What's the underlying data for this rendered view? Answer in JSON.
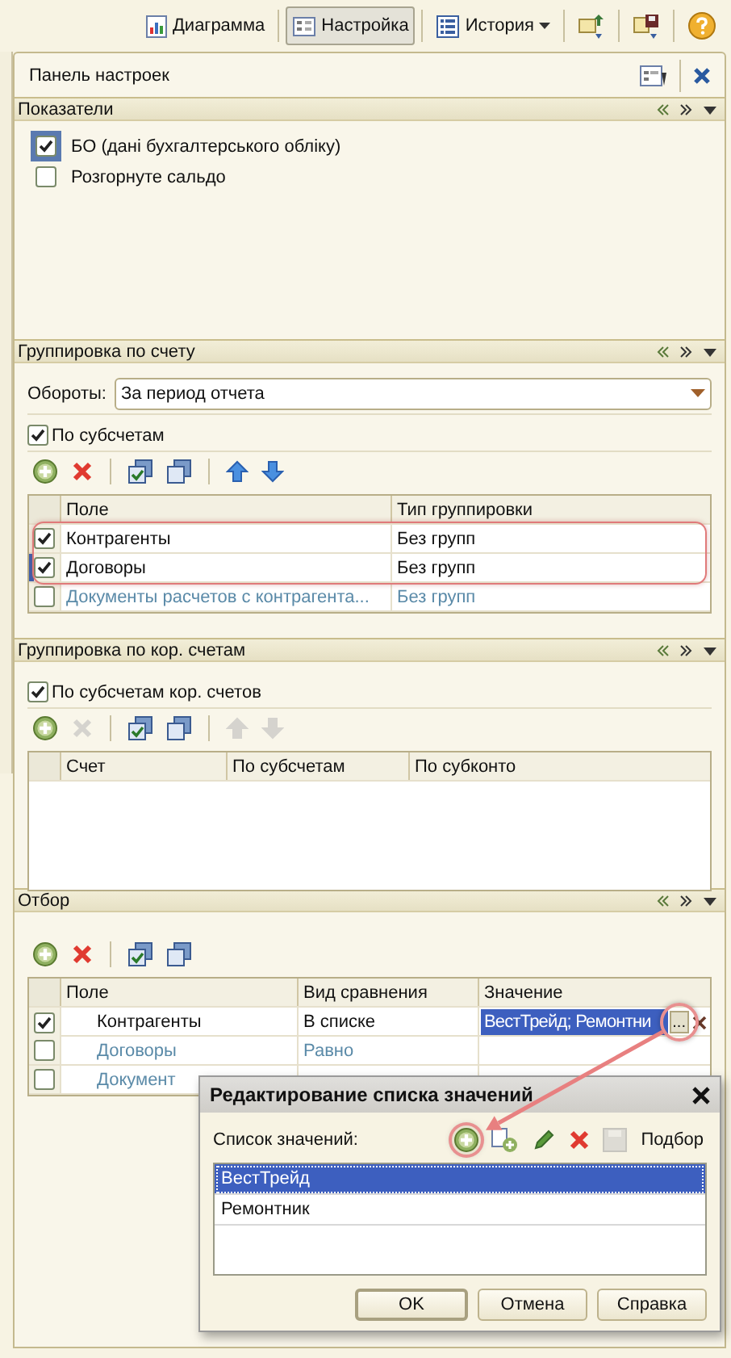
{
  "toolbar": {
    "buttons": [
      {
        "kind": "chart",
        "label": "Диаграмма",
        "selected": false
      },
      {
        "kind": "settings",
        "label": "Настройка",
        "selected": true
      },
      {
        "kind": "history",
        "label": "История",
        "selected": false
      },
      {
        "kind": "export",
        "selected": false
      },
      {
        "kind": "save",
        "selected": false
      },
      {
        "kind": "help",
        "selected": false
      }
    ]
  },
  "panel": {
    "title": "Панель настроек",
    "sections": [
      {
        "kind": "checklist",
        "title": "Показатели",
        "items": [
          {
            "label": "БО (дані бухгалтерського обліку)",
            "checked": true,
            "current": true
          },
          {
            "label": "Розгорнуте сальдо",
            "checked": false,
            "current": false
          }
        ]
      },
      {
        "kind": "grouping",
        "title": "Группировка по счету",
        "select": {
          "label": "Обороты:",
          "value": "За период отчета"
        },
        "option": {
          "label": "По субсчетам",
          "checked": true
        },
        "tools": [
          {
            "kind": "add",
            "disabled": false
          },
          {
            "kind": "delete",
            "disabled": false
          },
          {
            "kind": "check-all",
            "disabled": false
          },
          {
            "kind": "uncheck-all",
            "disabled": false
          },
          {
            "kind": "up",
            "disabled": false
          },
          {
            "kind": "down",
            "disabled": false
          }
        ],
        "columns": [
          "Поле",
          "Тип группировки"
        ],
        "rows": [
          {
            "checked": true,
            "active": true,
            "current": false,
            "highlighted": true,
            "cells": [
              "Контрагенты",
              "Без групп"
            ]
          },
          {
            "checked": true,
            "active": true,
            "current": true,
            "highlighted": true,
            "cells": [
              "Договоры",
              "Без групп"
            ]
          },
          {
            "checked": false,
            "active": false,
            "current": false,
            "highlighted": false,
            "cells": [
              "Документы расчетов с контрагента...",
              "Без групп"
            ]
          }
        ]
      },
      {
        "kind": "grouping",
        "title": "Группировка по кор. счетам",
        "option": {
          "label": "По субсчетам кор. счетов",
          "checked": true
        },
        "tools": [
          {
            "kind": "add",
            "disabled": false
          },
          {
            "kind": "delete",
            "disabled": true
          },
          {
            "kind": "check-all",
            "disabled": false
          },
          {
            "kind": "uncheck-all",
            "disabled": false
          },
          {
            "kind": "up",
            "disabled": true
          },
          {
            "kind": "down",
            "disabled": true
          }
        ],
        "columns": [
          "Счет",
          "По субсчетам",
          "По субконто"
        ]
      },
      {
        "kind": "filter",
        "title": "Отбор",
        "tools": [
          {
            "kind": "add",
            "disabled": false
          },
          {
            "kind": "delete",
            "disabled": false
          },
          {
            "kind": "check-all",
            "disabled": false
          },
          {
            "kind": "uncheck-all",
            "disabled": false
          }
        ],
        "columns": [
          "Поле",
          "Вид сравнения",
          "Значение"
        ],
        "rows": [
          {
            "checked": true,
            "active": true,
            "cells": [
              "Контрагенты",
              "В списке",
              "ВестТрейд; Ремонтни"
            ],
            "choose_label": "..."
          },
          {
            "checked": false,
            "active": false,
            "cells": [
              "Договоры",
              "Равно"
            ]
          },
          {
            "checked": false,
            "active": false,
            "cells": [
              "Документ"
            ]
          }
        ]
      }
    ]
  },
  "dialog": {
    "title": "Редактирование списка значений",
    "label": "Список значений:",
    "tools": [
      {
        "kind": "add",
        "disabled": false,
        "highlighted": true
      },
      {
        "kind": "add-copy",
        "disabled": false,
        "highlighted": false
      },
      {
        "kind": "edit",
        "disabled": false,
        "highlighted": false
      },
      {
        "kind": "delete",
        "disabled": false,
        "highlighted": false
      },
      {
        "kind": "save",
        "disabled": true,
        "highlighted": false
      }
    ],
    "pick_label": "Подбор",
    "items": [
      {
        "label": "ВестТрейд",
        "selected": true
      },
      {
        "label": "Ремонтник",
        "selected": false
      }
    ],
    "buttons": [
      {
        "label": "OK",
        "default": true
      },
      {
        "label": "Отмена",
        "default": false
      },
      {
        "label": "Справка",
        "default": false
      }
    ]
  }
}
